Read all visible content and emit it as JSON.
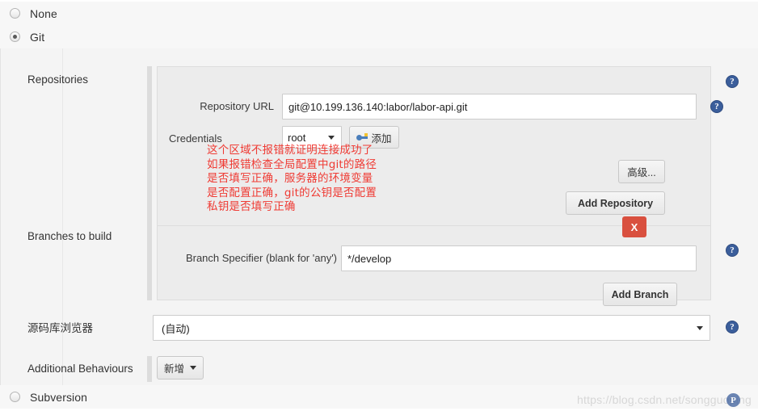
{
  "scm": {
    "options": [
      {
        "label": "None",
        "selected": false
      },
      {
        "label": "Git",
        "selected": true
      },
      {
        "label": "Subversion",
        "selected": false
      }
    ]
  },
  "repositories": {
    "section_label": "Repositories",
    "repository_url": {
      "label": "Repository URL",
      "value": "git@10.199.136.140:labor/labor-api.git"
    },
    "credentials": {
      "label": "Credentials",
      "value": "root",
      "add_button": "添加",
      "add_button_icon": "key-icon"
    },
    "advanced_button": "高级...",
    "add_repository_button": "Add Repository"
  },
  "annotation": {
    "lines": [
      "这个区域不报错就证明连接成功了",
      "如果报错检查全局配置中git的路径",
      "是否填写正确，服务器的环境变量",
      "是否配置正确，git的公钥是否配置",
      "私钥是否填写正确"
    ],
    "color": "#ef3b34"
  },
  "branches": {
    "section_label": "Branches to build",
    "branch_specifier": {
      "label": "Branch Specifier (blank for 'any')",
      "value": "*/develop"
    },
    "delete_button": "X",
    "add_branch_button": "Add Branch"
  },
  "repository_browser": {
    "label": "源码库浏览器",
    "value": "(自动)"
  },
  "additional_behaviours": {
    "label": "Additional Behaviours",
    "add_button": "新增",
    "caret_icon": "chevron-down-icon"
  },
  "help_icon_glyph": "?",
  "watermark": {
    "text": "https://blog.csdn.net/songguoping",
    "badge": "P"
  },
  "colors": {
    "panel_bg": "#f4f4f4",
    "block_bg": "#ececec",
    "danger": "#d9503f",
    "help_blue": "#3b5e9b"
  }
}
